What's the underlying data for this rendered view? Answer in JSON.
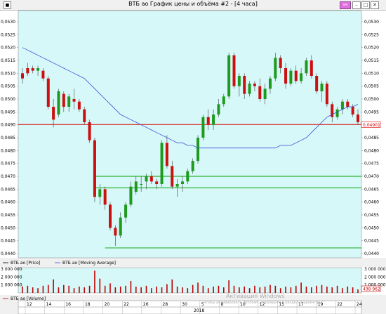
{
  "window": {
    "title": "ВТБ ао График цены и объёма #2 - [4 часа]"
  },
  "price_panel": {
    "legend": [
      {
        "name": "ВТБ ао [Price]",
        "color": "#000000"
      },
      {
        "name": "ВТБ ао [Moving Average]",
        "color": "#3a4fd8"
      }
    ],
    "y_ticks": [
      "0,0530",
      "0,0525",
      "0,0520",
      "0,0515",
      "0,0510",
      "0,0505",
      "0,0500",
      "0,0495",
      "0,0490",
      "0,0485",
      "0,0480",
      "0,0475",
      "0,0470",
      "0,0465",
      "0,0460",
      "0,0455",
      "0,0450",
      "0,0445",
      "0,0440"
    ],
    "current_price_label": "0,04901",
    "current_price": 0.04901,
    "background": "#d7f8f8"
  },
  "volume_panel": {
    "legend": [
      {
        "name": "ВТБ ао [Volume]",
        "color": "#c00000"
      }
    ],
    "y_ticks": [
      "3 000 000",
      "2 000 000",
      "1 000 000"
    ],
    "current_volume_label": "438 962"
  },
  "x_axis": {
    "day_labels": [
      "12",
      "14",
      "16",
      "18",
      "20",
      "22",
      "26",
      "28",
      "30",
      "5",
      "8",
      "10",
      "12",
      "15",
      "17",
      "19",
      "22",
      "24"
    ],
    "year_label": "2018"
  },
  "watermark": {
    "line1": "Активация Windows",
    "line2": "Чтобы активировать Windows, перейдите в раздел \"Параметры\"."
  },
  "chart_data": {
    "type": "candlestick",
    "ylim": [
      0.044,
      0.053
    ],
    "volume_ylim": [
      0,
      3000000
    ],
    "candles": [
      {
        "o": 0.051,
        "h": 0.0512,
        "l": 0.0506,
        "c": 0.0508
      },
      {
        "o": 0.0512,
        "h": 0.0514,
        "l": 0.0509,
        "c": 0.051
      },
      {
        "o": 0.0512,
        "h": 0.0513,
        "l": 0.051,
        "c": 0.0511
      },
      {
        "o": 0.0511,
        "h": 0.0513,
        "l": 0.0509,
        "c": 0.0512
      },
      {
        "o": 0.0511,
        "h": 0.0512,
        "l": 0.0507,
        "c": 0.0508
      },
      {
        "o": 0.0508,
        "h": 0.0509,
        "l": 0.0496,
        "c": 0.0497
      },
      {
        "o": 0.0497,
        "h": 0.05,
        "l": 0.0489,
        "c": 0.0492
      },
      {
        "o": 0.0494,
        "h": 0.0504,
        "l": 0.0493,
        "c": 0.0503
      },
      {
        "o": 0.0502,
        "h": 0.0503,
        "l": 0.0495,
        "c": 0.0497
      },
      {
        "o": 0.0497,
        "h": 0.0502,
        "l": 0.0495,
        "c": 0.0501
      },
      {
        "o": 0.05,
        "h": 0.0504,
        "l": 0.0496,
        "c": 0.0499
      },
      {
        "o": 0.0499,
        "h": 0.05,
        "l": 0.0495,
        "c": 0.0496
      },
      {
        "o": 0.0496,
        "h": 0.0497,
        "l": 0.049,
        "c": 0.0491
      },
      {
        "o": 0.0491,
        "h": 0.0492,
        "l": 0.0483,
        "c": 0.0484
      },
      {
        "o": 0.0484,
        "h": 0.0485,
        "l": 0.046,
        "c": 0.0462
      },
      {
        "o": 0.0462,
        "h": 0.0467,
        "l": 0.0459,
        "c": 0.0465
      },
      {
        "o": 0.0465,
        "h": 0.0466,
        "l": 0.0457,
        "c": 0.0459
      },
      {
        "o": 0.0459,
        "h": 0.046,
        "l": 0.0449,
        "c": 0.045
      },
      {
        "o": 0.045,
        "h": 0.0451,
        "l": 0.0443,
        "c": 0.0447
      },
      {
        "o": 0.0447,
        "h": 0.0456,
        "l": 0.0446,
        "c": 0.0454
      },
      {
        "o": 0.0454,
        "h": 0.046,
        "l": 0.0452,
        "c": 0.0459
      },
      {
        "o": 0.0459,
        "h": 0.0468,
        "l": 0.0458,
        "c": 0.0466
      },
      {
        "o": 0.0464,
        "h": 0.047,
        "l": 0.0463,
        "c": 0.0468
      },
      {
        "o": 0.0467,
        "h": 0.047,
        "l": 0.0464,
        "c": 0.0467
      },
      {
        "o": 0.0468,
        "h": 0.0471,
        "l": 0.0465,
        "c": 0.047
      },
      {
        "o": 0.047,
        "h": 0.0472,
        "l": 0.0467,
        "c": 0.0468
      },
      {
        "o": 0.0468,
        "h": 0.0469,
        "l": 0.0465,
        "c": 0.0467
      },
      {
        "o": 0.0467,
        "h": 0.0484,
        "l": 0.0466,
        "c": 0.0483
      },
      {
        "o": 0.0483,
        "h": 0.0486,
        "l": 0.0473,
        "c": 0.0474
      },
      {
        "o": 0.0474,
        "h": 0.0476,
        "l": 0.0465,
        "c": 0.0466
      },
      {
        "o": 0.0466,
        "h": 0.0469,
        "l": 0.0462,
        "c": 0.0467
      },
      {
        "o": 0.0467,
        "h": 0.047,
        "l": 0.0464,
        "c": 0.0468
      },
      {
        "o": 0.0468,
        "h": 0.0473,
        "l": 0.0467,
        "c": 0.0472
      },
      {
        "o": 0.0472,
        "h": 0.0477,
        "l": 0.0471,
        "c": 0.0476
      },
      {
        "o": 0.0476,
        "h": 0.0486,
        "l": 0.0475,
        "c": 0.0485
      },
      {
        "o": 0.0485,
        "h": 0.0494,
        "l": 0.0484,
        "c": 0.0493
      },
      {
        "o": 0.0493,
        "h": 0.0496,
        "l": 0.0488,
        "c": 0.049
      },
      {
        "o": 0.049,
        "h": 0.0496,
        "l": 0.0488,
        "c": 0.0494
      },
      {
        "o": 0.0494,
        "h": 0.05,
        "l": 0.0493,
        "c": 0.0498
      },
      {
        "o": 0.0498,
        "h": 0.0502,
        "l": 0.0497,
        "c": 0.0501
      },
      {
        "o": 0.0501,
        "h": 0.0518,
        "l": 0.05,
        "c": 0.0517
      },
      {
        "o": 0.0517,
        "h": 0.0518,
        "l": 0.0504,
        "c": 0.0505
      },
      {
        "o": 0.0505,
        "h": 0.051,
        "l": 0.0501,
        "c": 0.0509
      },
      {
        "o": 0.0509,
        "h": 0.051,
        "l": 0.05,
        "c": 0.0502
      },
      {
        "o": 0.0502,
        "h": 0.0507,
        "l": 0.0501,
        "c": 0.0506
      },
      {
        "o": 0.0506,
        "h": 0.0507,
        "l": 0.0503,
        "c": 0.0505
      },
      {
        "o": 0.0505,
        "h": 0.0508,
        "l": 0.0499,
        "c": 0.05
      },
      {
        "o": 0.05,
        "h": 0.0506,
        "l": 0.0498,
        "c": 0.0504
      },
      {
        "o": 0.0504,
        "h": 0.0509,
        "l": 0.0502,
        "c": 0.0508
      },
      {
        "o": 0.0508,
        "h": 0.0518,
        "l": 0.0507,
        "c": 0.0516
      },
      {
        "o": 0.0516,
        "h": 0.0517,
        "l": 0.051,
        "c": 0.0512
      },
      {
        "o": 0.0512,
        "h": 0.0514,
        "l": 0.0504,
        "c": 0.0506
      },
      {
        "o": 0.0506,
        "h": 0.0512,
        "l": 0.0505,
        "c": 0.0511
      },
      {
        "o": 0.0511,
        "h": 0.0513,
        "l": 0.0506,
        "c": 0.0507
      },
      {
        "o": 0.0507,
        "h": 0.0512,
        "l": 0.0506,
        "c": 0.051
      },
      {
        "o": 0.051,
        "h": 0.0516,
        "l": 0.0509,
        "c": 0.0515
      },
      {
        "o": 0.0515,
        "h": 0.0517,
        "l": 0.0508,
        "c": 0.0509
      },
      {
        "o": 0.0509,
        "h": 0.051,
        "l": 0.0502,
        "c": 0.0503
      },
      {
        "o": 0.0503,
        "h": 0.0507,
        "l": 0.0499,
        "c": 0.0506
      },
      {
        "o": 0.0506,
        "h": 0.0507,
        "l": 0.0497,
        "c": 0.0498
      },
      {
        "o": 0.0498,
        "h": 0.0499,
        "l": 0.0491,
        "c": 0.0493
      },
      {
        "o": 0.0493,
        "h": 0.0497,
        "l": 0.0492,
        "c": 0.0496
      },
      {
        "o": 0.0496,
        "h": 0.05,
        "l": 0.0494,
        "c": 0.0499
      },
      {
        "o": 0.0499,
        "h": 0.05,
        "l": 0.0496,
        "c": 0.0497
      },
      {
        "o": 0.0497,
        "h": 0.0498,
        "l": 0.0493,
        "c": 0.0494
      },
      {
        "o": 0.0494,
        "h": 0.0496,
        "l": 0.049,
        "c": 0.0491
      }
    ],
    "moving_average": [
      0.052,
      0.0519,
      0.0518,
      0.0517,
      0.0516,
      0.0515,
      0.0514,
      0.0513,
      0.0512,
      0.0511,
      0.051,
      0.0509,
      0.0508,
      0.0506,
      0.0504,
      0.0502,
      0.05,
      0.0498,
      0.0496,
      0.0494,
      0.0493,
      0.0492,
      0.0491,
      0.049,
      0.0489,
      0.0488,
      0.0487,
      0.0486,
      0.0485,
      0.0484,
      0.0483,
      0.0483,
      0.0482,
      0.0482,
      0.0481,
      0.0481,
      0.0481,
      0.0481,
      0.0481,
      0.0481,
      0.0481,
      0.0481,
      0.0481,
      0.0481,
      0.0481,
      0.0481,
      0.0481,
      0.0481,
      0.0481,
      0.0481,
      0.0482,
      0.0482,
      0.0482,
      0.0483,
      0.0484,
      0.0485,
      0.0487,
      0.0489,
      0.0491,
      0.0493,
      0.0494,
      0.0495,
      0.0496,
      0.0497,
      0.0497,
      0.0498
    ],
    "volumes": [
      800000,
      900000,
      700000,
      600000,
      900000,
      1000000,
      1700000,
      700000,
      1000000,
      900000,
      600000,
      800000,
      700000,
      900000,
      2800000,
      1800000,
      900000,
      1200000,
      700000,
      800000,
      900000,
      1500000,
      800000,
      700000,
      900000,
      600000,
      800000,
      700000,
      1100000,
      1700000,
      800000,
      700000,
      600000,
      1000000,
      1300000,
      900000,
      600000,
      800000,
      900000,
      700000,
      1600000,
      900000,
      700000,
      800000,
      600000,
      900000,
      700000,
      800000,
      1000000,
      900000,
      600000,
      800000,
      700000,
      900000,
      1300000,
      800000,
      700000,
      900000,
      1000000,
      800000,
      700000,
      900000,
      600000,
      800000,
      700000,
      438962
    ],
    "horizontal_lines": [
      {
        "price": 0.04901,
        "color": "#d80000"
      },
      {
        "price": 0.047,
        "color": "#00a000"
      },
      {
        "price": 0.04655,
        "color": "#00a000"
      },
      {
        "price": 0.04422,
        "color": "#00a000"
      }
    ]
  }
}
